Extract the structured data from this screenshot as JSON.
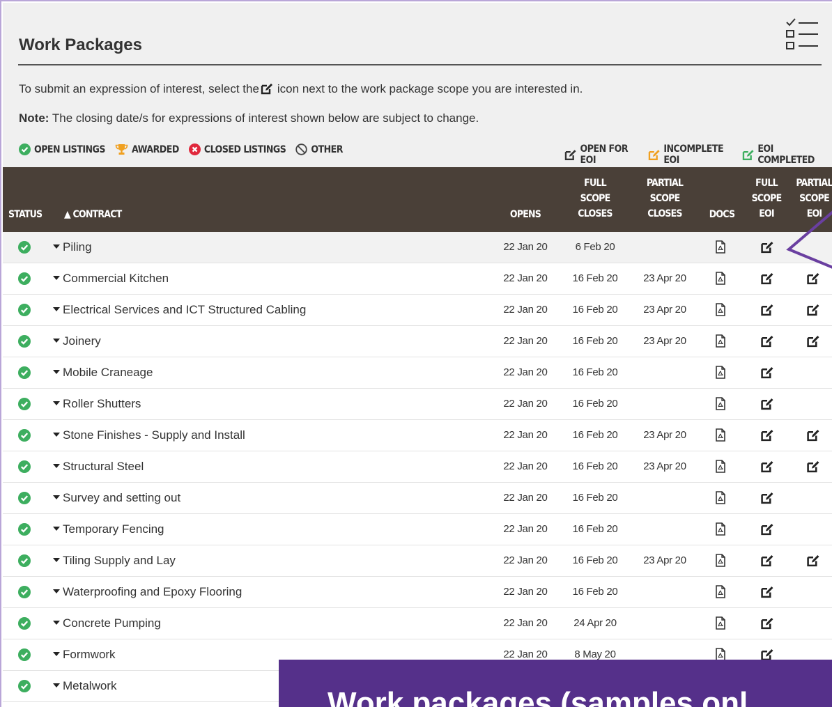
{
  "header": {
    "title": "Work Packages"
  },
  "intro": {
    "before": "To submit an expression of interest, select the",
    "after": "icon next to the work package scope you are interested in."
  },
  "note": {
    "label": "Note:",
    "text": "The closing date/s for expressions of interest shown below are subject to change."
  },
  "legend_left": [
    {
      "label": "OPEN LISTINGS",
      "icon": "check-circle-icon",
      "color": "#3dae5f"
    },
    {
      "label": "AWARDED",
      "icon": "trophy-icon",
      "color": "#f0a020"
    },
    {
      "label": "CLOSED LISTINGS",
      "icon": "x-circle-icon",
      "color": "#e0283c"
    },
    {
      "label": "OTHER",
      "icon": "ban-icon",
      "color": "#444444"
    }
  ],
  "legend_right": [
    {
      "label": "OPEN FOR EOI",
      "icon": "edit-icon",
      "color": "#333333"
    },
    {
      "label": "INCOMPLETE EOI",
      "icon": "edit-icon",
      "color": "#f0a020"
    },
    {
      "label": "EOI COMPLETED",
      "icon": "edit-icon",
      "color": "#3dae5f"
    }
  ],
  "table": {
    "headers": {
      "status": "STATUS",
      "contract": "▲ CONTRACT",
      "opens": "OPENS",
      "full_closes": [
        "FULL",
        "SCOPE",
        "CLOSES"
      ],
      "partial_closes": [
        "PARTIAL",
        "SCOPE",
        "CLOSES"
      ],
      "docs": "DOCS",
      "full_eoi": [
        "FULL",
        "SCOPE",
        "EOI"
      ],
      "partial_eoi": [
        "PARTIAL",
        "SCOPE",
        "EOI"
      ]
    },
    "rows": [
      {
        "name": "Piling",
        "opens": "22 Jan 20",
        "full": "6 Feb 20",
        "partial": "",
        "partial_eoi": false
      },
      {
        "name": "Commercial Kitchen",
        "opens": "22 Jan 20",
        "full": "16 Feb 20",
        "partial": "23 Apr 20",
        "partial_eoi": true
      },
      {
        "name": "Electrical Services and ICT Structured Cabling",
        "opens": "22 Jan 20",
        "full": "16 Feb 20",
        "partial": "23 Apr 20",
        "partial_eoi": true
      },
      {
        "name": "Joinery",
        "opens": "22 Jan 20",
        "full": "16 Feb 20",
        "partial": "23 Apr 20",
        "partial_eoi": true
      },
      {
        "name": "Mobile Craneage",
        "opens": "22 Jan 20",
        "full": "16 Feb 20",
        "partial": "",
        "partial_eoi": false
      },
      {
        "name": "Roller Shutters",
        "opens": "22 Jan 20",
        "full": "16 Feb 20",
        "partial": "",
        "partial_eoi": false
      },
      {
        "name": "Stone Finishes - Supply and Install",
        "opens": "22 Jan 20",
        "full": "16 Feb 20",
        "partial": "23 Apr 20",
        "partial_eoi": true
      },
      {
        "name": "Structural Steel",
        "opens": "22 Jan 20",
        "full": "16 Feb 20",
        "partial": "23 Apr 20",
        "partial_eoi": true
      },
      {
        "name": "Survey and setting out",
        "opens": "22 Jan 20",
        "full": "16 Feb 20",
        "partial": "",
        "partial_eoi": false
      },
      {
        "name": "Temporary Fencing",
        "opens": "22 Jan 20",
        "full": "16 Feb 20",
        "partial": "",
        "partial_eoi": false
      },
      {
        "name": "Tiling Supply and Lay",
        "opens": "22 Jan 20",
        "full": "16 Feb 20",
        "partial": "23 Apr 20",
        "partial_eoi": true
      },
      {
        "name": "Waterproofing and Epoxy Flooring",
        "opens": "22 Jan 20",
        "full": "16 Feb 20",
        "partial": "",
        "partial_eoi": false
      },
      {
        "name": "Concrete Pumping",
        "opens": "22 Jan 20",
        "full": "24 Apr 20",
        "partial": "",
        "partial_eoi": false
      },
      {
        "name": "Formwork",
        "opens": "22 Jan 20",
        "full": "8 May 20",
        "partial": "",
        "partial_eoi": false
      },
      {
        "name": "Metalwork",
        "opens": "",
        "full": "",
        "partial": "",
        "partial_eoi": false
      }
    ]
  },
  "banner": {
    "text": "Work packages (samples onl"
  },
  "colors": {
    "header_bg": "#4a4038",
    "banner_bg": "#55308a",
    "accent": "#6a3fa0",
    "open_green": "#3dae5f"
  }
}
